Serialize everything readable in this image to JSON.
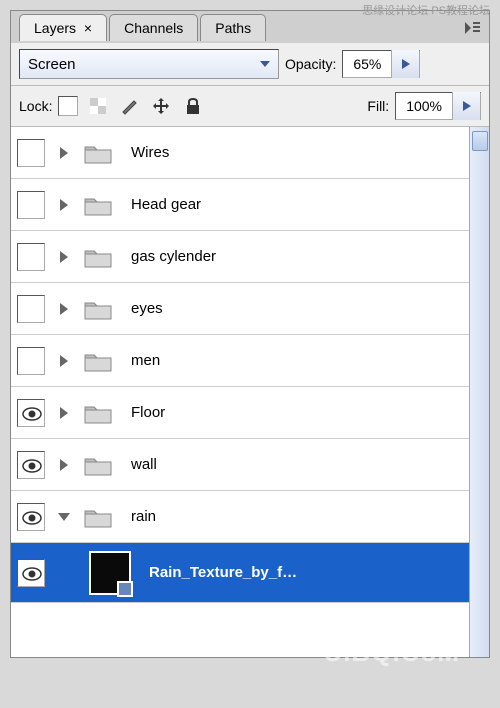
{
  "watermark_top": "思缘设计论坛  PS教程论坛",
  "tabs": [
    {
      "label": "Layers",
      "active": true,
      "close": "×"
    },
    {
      "label": "Channels",
      "active": false
    },
    {
      "label": "Paths",
      "active": false
    }
  ],
  "blend_mode": "Screen",
  "opacity_label": "Opacity:",
  "opacity_value": "65%",
  "lock_label": "Lock:",
  "fill_label": "Fill:",
  "fill_value": "100%",
  "layers": [
    {
      "name": "Wires",
      "type": "folder",
      "open": false,
      "visible": false
    },
    {
      "name": "Head gear",
      "type": "folder",
      "open": false,
      "visible": false
    },
    {
      "name": "gas cylender",
      "type": "folder",
      "open": false,
      "visible": false
    },
    {
      "name": "eyes",
      "type": "folder",
      "open": false,
      "visible": false
    },
    {
      "name": "men",
      "type": "folder",
      "open": false,
      "visible": false
    },
    {
      "name": "Floor",
      "type": "folder",
      "open": false,
      "visible": true
    },
    {
      "name": "wall",
      "type": "folder",
      "open": false,
      "visible": true
    },
    {
      "name": "rain",
      "type": "folder",
      "open": true,
      "visible": true
    },
    {
      "name": "Rain_Texture_by_f…",
      "type": "layer",
      "selected": true,
      "visible": true,
      "indent": true
    }
  ],
  "watermark_bottom": "UiBQ.CoM"
}
